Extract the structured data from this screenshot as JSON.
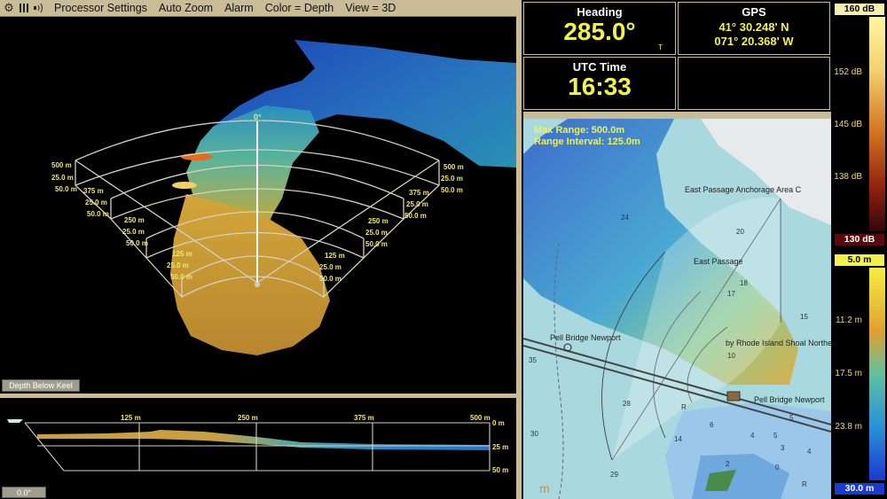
{
  "toolbar": {
    "icons": [
      "gear-icon",
      "columns-icon",
      "sonar-icon"
    ],
    "items": [
      "Processor Settings",
      "Auto Zoom",
      "Alarm",
      "Color = Depth",
      "View = 3D"
    ]
  },
  "view3d": {
    "angle_label": "0°",
    "ranges": [
      "125 m",
      "250 m",
      "375 m",
      "500 m"
    ],
    "depth_labels": [
      "25.0 m",
      "50.0 m"
    ],
    "depth_button": "Depth Below Keel"
  },
  "profile": {
    "range_labels": [
      "125 m",
      "250 m",
      "375 m",
      "500 m"
    ],
    "depth_labels": [
      "0 m",
      "25 m",
      "50 m"
    ],
    "angle_button": "0.0°"
  },
  "heading": {
    "label": "Heading",
    "value": "285.0°",
    "suffix": "T"
  },
  "gps": {
    "label": "GPS",
    "lat": "41° 30.248' N",
    "lon": "071° 20.368' W"
  },
  "utc": {
    "label": "UTC Time",
    "value": "16:33"
  },
  "chart": {
    "max_range": "Max Range: 500.0m",
    "range_interval": "Range Interval: 125.0m",
    "places": [
      "East Passage Anchorage Area C",
      "East Passage",
      "by Rhode Island Shoal Northea",
      "Pell Bridge Newport",
      "Pell Bridge Newport"
    ],
    "soundings": [
      "24",
      "20",
      "17",
      "18",
      "15",
      "10",
      "28",
      "14",
      "6",
      "4",
      "5",
      "5",
      "3",
      "4",
      "2",
      "0",
      "30",
      "35",
      "29",
      "R",
      "R"
    ],
    "unit": "m"
  },
  "scale_db": {
    "top": "160 dB",
    "bottom": "130 dB",
    "ticks": [
      "152 dB",
      "145 dB",
      "138 dB"
    ]
  },
  "scale_depth": {
    "top": "5.0 m",
    "bottom": "30.0 m",
    "ticks": [
      "11.2 m",
      "17.5 m",
      "23.8 m"
    ]
  },
  "colors": {
    "accent_yellow": "#f2f24a",
    "panel_border": "#c9bc97",
    "chart_water": "#a9d8de"
  }
}
